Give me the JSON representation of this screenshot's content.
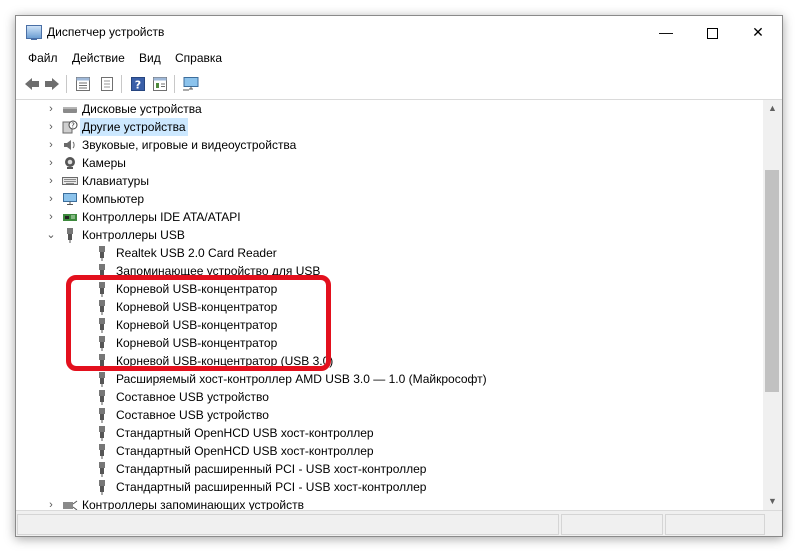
{
  "window": {
    "title": "Диспетчер устройств",
    "minimize_label": "—",
    "close_label": "✕"
  },
  "menu": {
    "file": "Файл",
    "action": "Действие",
    "view": "Вид",
    "help": "Справка"
  },
  "toolbar": {
    "buttons": [
      "back-icon",
      "forward-icon",
      "properties-list-icon",
      "properties-icon",
      "help-icon",
      "view-icon",
      "monitor-icon"
    ]
  },
  "tree": {
    "categories_top": [
      {
        "label": "Дисковые устройства",
        "icon": "disk-icon"
      },
      {
        "label": "Другие устройства",
        "icon": "unknown-device-icon",
        "selected": true
      },
      {
        "label": "Звуковые, игровые и видеоустройства",
        "icon": "speaker-icon"
      },
      {
        "label": "Камеры",
        "icon": "camera-icon"
      },
      {
        "label": "Клавиатуры",
        "icon": "keyboard-icon"
      },
      {
        "label": "Компьютер",
        "icon": "computer-icon"
      },
      {
        "label": "Контроллеры IDE ATA/ATAPI",
        "icon": "ide-controller-icon"
      }
    ],
    "usb_category": {
      "label": "Контроллеры USB",
      "icon": "usb-icon"
    },
    "usb_children": [
      "Realtek USB 2.0 Card Reader",
      "Запоминающее устройство для USB",
      "Корневой USB-концентратор",
      "Корневой USB-концентратор",
      "Корневой USB-концентратор",
      "Корневой USB-концентратор",
      "Корневой USB-концентратор (USB 3.0)",
      "Расширяемый хост-контроллер AMD USB 3.0 — 1.0 (Майкрософт)",
      "Составное USB устройство",
      "Составное USB устройство",
      "Стандартный OpenHCD USB хост-контроллер",
      "Стандартный OpenHCD USB хост-контроллер",
      "Стандартный расширенный PCI - USB хост-контроллер",
      "Стандартный расширенный PCI - USB хост-контроллер"
    ],
    "storage_category": {
      "label": "Контроллеры запоминающих устройств",
      "icon": "storage-controller-icon"
    }
  },
  "colors": {
    "highlight": "#e3101d",
    "selection": "#cce8ff"
  }
}
